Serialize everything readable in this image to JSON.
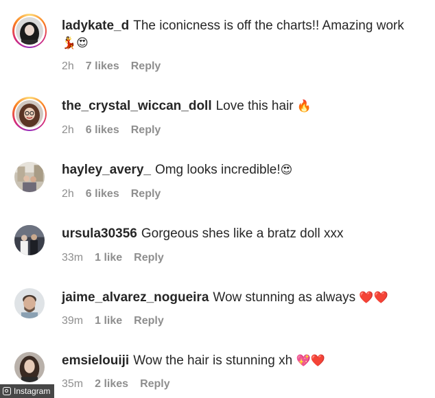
{
  "comments": [
    {
      "username": "ladykate_d",
      "text": "The iconicness is off the charts!! Amazing work",
      "emoji": "💃😍",
      "time": "2h",
      "likes": "7 likes",
      "reply": "Reply",
      "avatar_icon": "profile-photo-dark-hair-icon"
    },
    {
      "username": "the_crystal_wiccan_doll",
      "text": "Love this hair",
      "emoji": "🔥",
      "time": "2h",
      "likes": "6 likes",
      "reply": "Reply",
      "avatar_icon": "profile-photo-glasses-icon"
    },
    {
      "username": "hayley_avery_",
      "text": "Omg looks incredible!",
      "emoji": "😍",
      "time": "2h",
      "likes": "6 likes",
      "reply": "Reply",
      "avatar_icon": "profile-photo-outdoor-icon"
    },
    {
      "username": "ursula30356",
      "text": "Gorgeous shes like a bratz doll xxx",
      "emoji": "",
      "time": "33m",
      "likes": "1 like",
      "reply": "Reply",
      "avatar_icon": "profile-photo-group-icon"
    },
    {
      "username": "jaime_alvarez_nogueira",
      "text": "Wow stunning as always",
      "emoji": "❤️❤️",
      "time": "39m",
      "likes": "1 like",
      "reply": "Reply",
      "avatar_icon": "profile-photo-man-icon"
    },
    {
      "username": "emsielouiji",
      "text": "Wow the hair is stunning xh",
      "emoji": "💖❤️",
      "time": "35m",
      "likes": "2 likes",
      "reply": "Reply",
      "avatar_icon": "profile-photo-woman-icon"
    }
  ],
  "watermark": {
    "label": "Instagram",
    "icon": "instagram-icon"
  },
  "colors": {
    "text": "#262626",
    "meta": "#8e8e8e",
    "story_ring": "#d62976"
  }
}
